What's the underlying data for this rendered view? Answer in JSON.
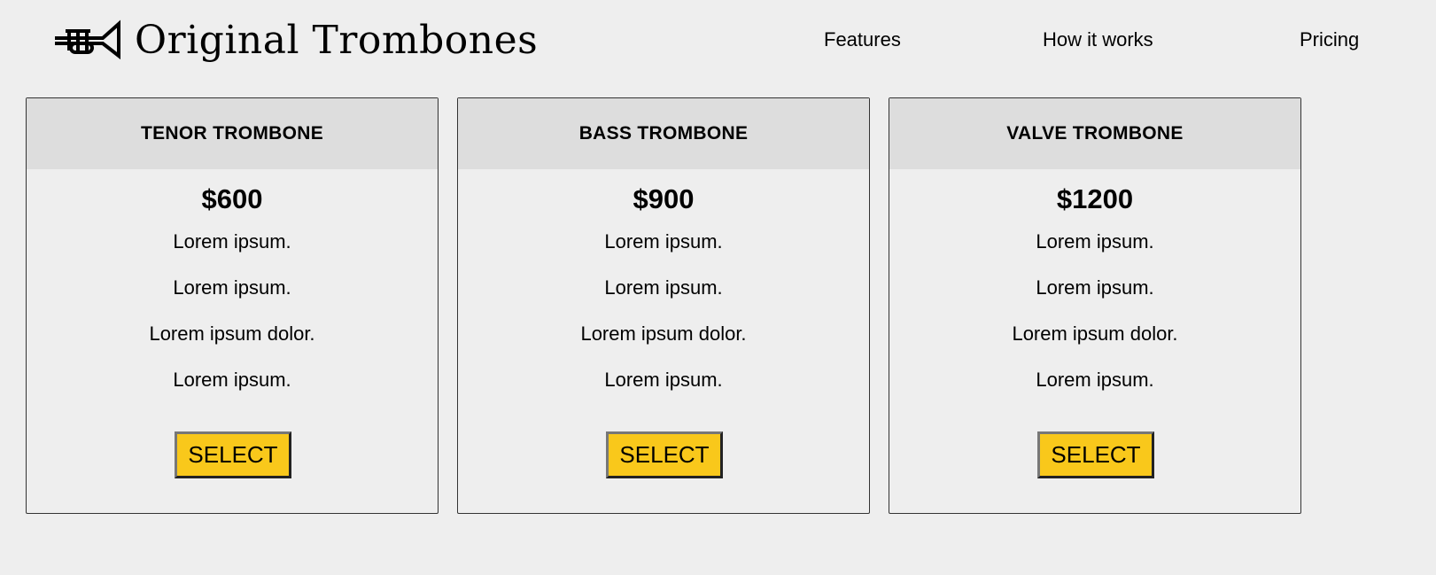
{
  "header": {
    "brand": "Original Trombones",
    "nav": [
      "Features",
      "How it works",
      "Pricing"
    ]
  },
  "plans": [
    {
      "name": "TENOR TROMBONE",
      "price": "$600",
      "features": [
        "Lorem ipsum.",
        "Lorem ipsum.",
        "Lorem ipsum dolor.",
        "Lorem ipsum."
      ],
      "button": "SELECT"
    },
    {
      "name": "BASS TROMBONE",
      "price": "$900",
      "features": [
        "Lorem ipsum.",
        "Lorem ipsum.",
        "Lorem ipsum dolor.",
        "Lorem ipsum."
      ],
      "button": "SELECT"
    },
    {
      "name": "VALVE TROMBONE",
      "price": "$1200",
      "features": [
        "Lorem ipsum.",
        "Lorem ipsum.",
        "Lorem ipsum dolor.",
        "Lorem ipsum."
      ],
      "button": "SELECT"
    }
  ],
  "colors": {
    "button": "#f9c81b",
    "card_header": "#dddddd",
    "background": "#eeeeee"
  }
}
